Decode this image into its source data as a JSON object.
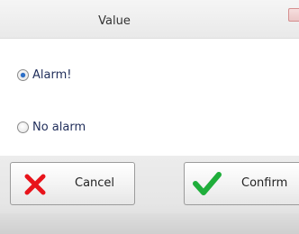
{
  "dialog": {
    "title": "Value"
  },
  "options": [
    {
      "label": "Alarm!",
      "selected": true
    },
    {
      "label": "No alarm",
      "selected": false
    }
  ],
  "buttons": {
    "cancel_label": "Cancel",
    "cancel_icon": "red-x-icon",
    "confirm_label": "Confirm",
    "confirm_icon": "green-check-icon"
  },
  "colors": {
    "cancel_icon": "#e8141b",
    "confirm_icon": "#1fae3b",
    "radio_selected": "#2a6ec8"
  }
}
